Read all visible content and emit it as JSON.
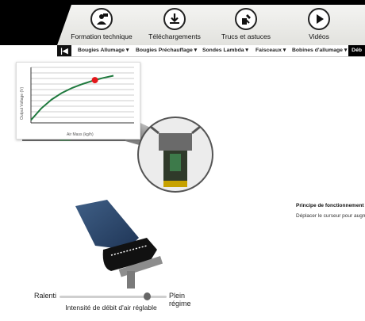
{
  "nav": {
    "items": [
      {
        "label": "Formation technique",
        "icon": "teacher-icon"
      },
      {
        "label": "Téléchargements",
        "icon": "download-icon"
      },
      {
        "label": "Trucs et astuces",
        "icon": "tools-icon"
      },
      {
        "label": "Vidéos",
        "icon": "play-icon"
      }
    ]
  },
  "subnav": {
    "back_label": "|◀",
    "items": [
      "Bougies Allumage ▾",
      "Bougies Préchauffage ▾",
      "Sondes Lambda ▾",
      "Faisceaux ▾",
      "Bobines d'allumage ▾"
    ],
    "active": "Déb"
  },
  "chart_data": {
    "type": "line",
    "xlabel": "Air Mass (kg/h)",
    "ylabel": "Output Voltage (V)",
    "grid": true,
    "series": [
      {
        "x": [
          0.0,
          0.1,
          0.2,
          0.3,
          0.4,
          0.5,
          0.6,
          0.7,
          0.8
        ],
        "y": [
          0.5,
          2.6,
          4.2,
          5.4,
          6.3,
          7.0,
          7.6,
          8.1,
          8.5
        ]
      }
    ],
    "marker": {
      "x": 0.62,
      "y": 7.7
    },
    "xlim": [
      0,
      1
    ],
    "ylim": [
      0,
      10
    ]
  },
  "slider": {
    "min_label": "Ralenti",
    "max_label": "Plein régime",
    "caption": "Intensité de débit d'air réglable",
    "value_fraction": 0.82
  },
  "info": {
    "title": "Principe de fonctionnement",
    "description": "Déplacer le curseur pour augm"
  },
  "colors": {
    "curve": "#1f7a3e",
    "marker": "#e3171b"
  }
}
